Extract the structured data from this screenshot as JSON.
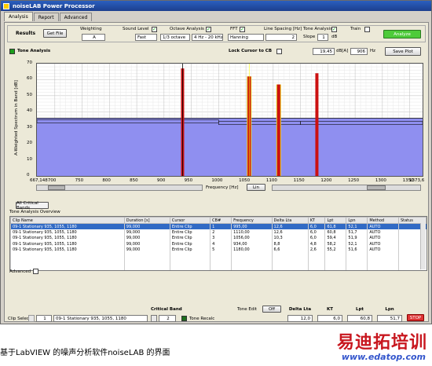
{
  "window": {
    "title": "noiseLAB Power Processor"
  },
  "tabs": [
    "Analysis",
    "Report",
    "Advanced"
  ],
  "toolbar": {
    "results_label": "Results",
    "get_file": "Get File",
    "weighting_label": "Weighting",
    "weighting_value": "A",
    "sound_level_label": "Sound Level",
    "sound_level_value": "Fast",
    "octave_label": "Octave Analysis",
    "octave_value1": "1/3 octave",
    "octave_value2": "4 Hz - 20 kHz",
    "fft_label": "FFT",
    "fft_value": "Hanning",
    "line_spacing_label": "Line Spacing [Hz]",
    "line_spacing_value": "2",
    "tone_label": "Tone Analysis",
    "slope_label": "Slope",
    "slope_value": "1",
    "slope_unit": "dB",
    "train_label": "Train",
    "analyze": "Analyze"
  },
  "tone": {
    "title": "Tone Analysis",
    "lock_label": "Lock Cursor to CB",
    "readout_db": "19,45",
    "readout_db_unit": "dB[A]",
    "readout_hz": "906",
    "readout_hz_unit": "Hz",
    "save_plot": "Save Plot"
  },
  "chart_data": {
    "type": "bar",
    "ylabel": "A-Weighted Spectrum in Band [dB]",
    "xlabel": "Frequency [Hz]",
    "xlim": [
      667.148,
      1373.6
    ],
    "ylim": [
      0,
      70
    ],
    "x_ticks": [
      "667,148",
      "700",
      "750",
      "800",
      "850",
      "900",
      "950",
      "1000",
      "1050",
      "1100",
      "1150",
      "1200",
      "1250",
      "1300",
      "1350",
      "1373,6"
    ],
    "y_ticks": [
      "0",
      "10",
      "20",
      "30",
      "40",
      "50",
      "60",
      "70"
    ],
    "spectrum_level": 36,
    "critical_band_levels": [
      {
        "from": 667.148,
        "to": 1000,
        "level": 34
      },
      {
        "from": 1000,
        "to": 1150,
        "level": 33
      },
      {
        "from": 1150,
        "to": 1373.6,
        "level": 33
      }
    ],
    "tones": [
      {
        "freq": 934,
        "value": 67
      },
      {
        "freq": 1056,
        "value": 62
      },
      {
        "freq": 1110,
        "value": 57
      },
      {
        "freq": 1180,
        "value": 64
      }
    ],
    "scale_button": "Lin"
  },
  "cb_button": "All Critical Bands",
  "overview": {
    "title": "Tone Analysis Overview",
    "columns": [
      "Clip Name",
      "Duration [s]",
      "Cursor",
      "CB#",
      "Frequency",
      "Delta Lta",
      "KT",
      "Lpt",
      "Lpn",
      "Method",
      "Status"
    ],
    "rows": [
      [
        "09-1 Stationary 935, 1055, 1180",
        "99,000",
        "Entire Clip",
        "1",
        "995,00",
        "12,6",
        "6,0",
        "61,8",
        "52,1",
        "AUTO",
        ""
      ],
      [
        "09-1 Stationary 935, 1055, 1180",
        "99,000",
        "Entire Clip",
        "2",
        "1110,00",
        "12,6",
        "6,0",
        "60,8",
        "51,7",
        "AUTO",
        ""
      ],
      [
        "09-1 Stationary 935, 1055, 1180",
        "99,000",
        "Entire Clip",
        "3",
        "1056,00",
        "10,3",
        "6,0",
        "59,4",
        "51,9",
        "AUTO",
        ""
      ],
      [
        "09-1 Stationary 935, 1055, 1180",
        "99,000",
        "Entire Clip",
        "4",
        "934,00",
        "8,8",
        "4,8",
        "58,2",
        "52,1",
        "AUTO",
        ""
      ],
      [
        "09-1 Stationary 935, 1055, 1180",
        "99,000",
        "Entire Clip",
        "5",
        "1180,00",
        "6,6",
        "2,6",
        "55,2",
        "51,6",
        "AUTO",
        ""
      ]
    ]
  },
  "advanced_label": "Advanced",
  "footer": {
    "clip_select_label": "Clip Select",
    "clip_index": "1",
    "clip_name": "09-1 Stationary 935, 1055, 1180",
    "critical_band_label": "Critical Band",
    "critical_band_value": "2",
    "tone_recalc": "Tone Recalc",
    "tone_edit_label": "Tone Edit",
    "tone_edit_value": "Off",
    "delta_lta_label": "Delta Lta",
    "delta_lta_value": "12,0",
    "kt_label": "KT",
    "kt_value": "6,0",
    "lpt_label": "Lpt",
    "lpt_value": "60,8",
    "lpn_label": "Lpn",
    "lpn_value": "51,7",
    "stop": "STOP"
  },
  "caption": "基于LabVIEW 的噪声分析软件noiseLAB 的界面",
  "watermark": {
    "logo": "易迪拓培训",
    "url": "www.edatop.com"
  },
  "colors": {
    "accent": "#2b5fbf",
    "spectrum": "#8f8ff0",
    "tone_red": "#cc1111",
    "tone_yellow": "#e8d020",
    "analyze_green": "#4ecb3a"
  }
}
